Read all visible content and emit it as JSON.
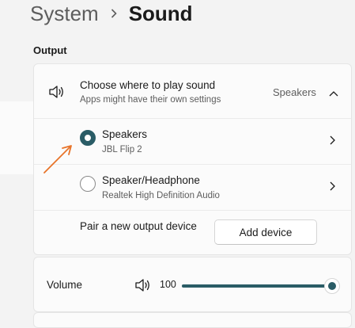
{
  "breadcrumb": {
    "parent": "System",
    "current": "Sound"
  },
  "section": {
    "label": "Output"
  },
  "output": {
    "title": "Choose where to play sound",
    "subtitle": "Apps might have their own settings",
    "selected": "Speakers",
    "devices": [
      {
        "name": "Speakers",
        "description": "JBL Flip 2",
        "selected": true
      },
      {
        "name": "Speaker/Headphone",
        "description": "Realtek High Definition Audio",
        "selected": false
      }
    ],
    "pair_label": "Pair a new output device",
    "add_button": "Add device"
  },
  "volume": {
    "label": "Volume",
    "value": "100",
    "level_percent": 100
  },
  "colors": {
    "accent": "#2a5c66",
    "annotation_arrow": "#e8742a"
  },
  "icons": [
    "chevron-right-icon",
    "speaker-icon",
    "chevron-up-icon",
    "volume-icon",
    "annotation-arrow-icon"
  ]
}
